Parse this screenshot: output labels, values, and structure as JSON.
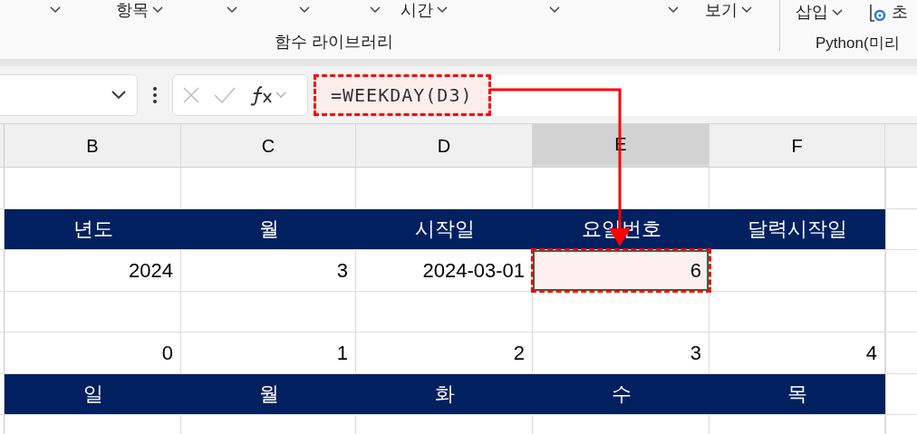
{
  "ribbon": {
    "items": [
      {
        "kind": "arrow"
      },
      {
        "kind": "labeled",
        "label": "항목"
      },
      {
        "kind": "arrow"
      },
      {
        "kind": "arrow"
      },
      {
        "kind": "arrow"
      },
      {
        "kind": "labeled",
        "label": "시간"
      },
      {
        "kind": "arrow"
      },
      {
        "kind": "arrow"
      },
      {
        "kind": "labeled",
        "label": "보기"
      }
    ],
    "group_label": "함수 라이브러리",
    "right_items": [
      {
        "label": "삽입"
      },
      {
        "label": "초"
      }
    ],
    "right_group_label": "Python(미리"
  },
  "formula_bar": {
    "formula": "=WEEKDAY(D3)"
  },
  "columns": [
    {
      "label": "B",
      "selected": false
    },
    {
      "label": "C",
      "selected": false
    },
    {
      "label": "D",
      "selected": false
    },
    {
      "label": "E",
      "selected": true
    },
    {
      "label": "F",
      "selected": false
    }
  ],
  "rows": [
    {
      "kind": "plain",
      "cells": [
        "",
        "",
        "",
        "",
        ""
      ]
    },
    {
      "kind": "header",
      "cells": [
        "년도",
        "월",
        "시작일",
        "요일번호",
        "달력시작일"
      ]
    },
    {
      "kind": "plain",
      "cells": [
        "2024",
        "3",
        "2024-03-01",
        "6",
        ""
      ],
      "selected_cells": [
        false,
        false,
        false,
        true,
        false
      ]
    },
    {
      "kind": "plain",
      "cells": [
        "",
        "",
        "",
        "",
        ""
      ]
    },
    {
      "kind": "plain",
      "cells": [
        "0",
        "1",
        "2",
        "3",
        "4"
      ]
    },
    {
      "kind": "header",
      "cells": [
        "일",
        "월",
        "화",
        "수",
        "목"
      ]
    },
    {
      "kind": "plain",
      "cells": [
        "",
        "",
        "",
        "",
        ""
      ]
    }
  ]
}
